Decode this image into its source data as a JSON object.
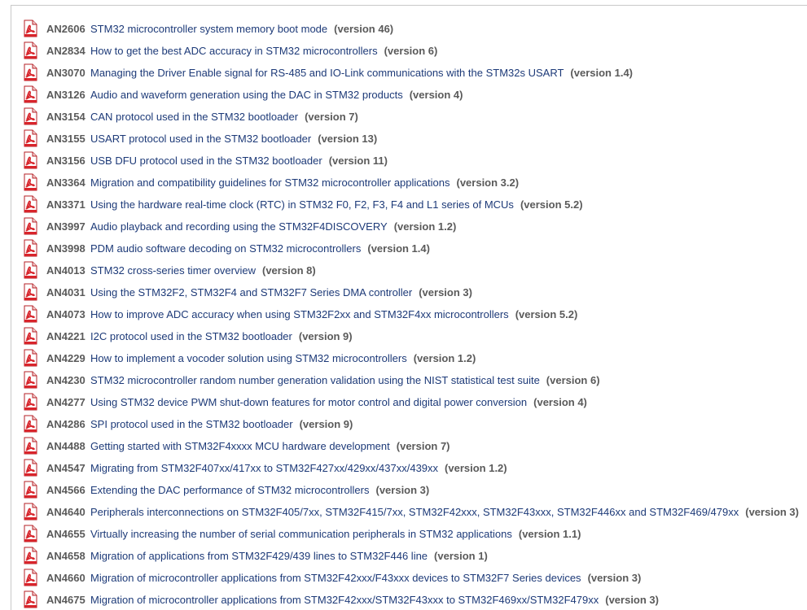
{
  "accent_colors": {
    "link": "#1d3a78",
    "code": "#5a5a5a",
    "pdf_icon": "#d8242b"
  },
  "documents": [
    {
      "code": "AN2606",
      "title": "STM32 microcontroller system memory boot mode",
      "version": "(version 46)",
      "icon": "pdf-icon"
    },
    {
      "code": "AN2834",
      "title": "How to get the best ADC accuracy in STM32 microcontrollers",
      "version": "(version 6)",
      "icon": "pdf-icon"
    },
    {
      "code": "AN3070",
      "title": "Managing the Driver Enable signal for RS-485 and IO-Link communications with the STM32s USART",
      "version": "(version 1.4)",
      "icon": "pdf-icon"
    },
    {
      "code": "AN3126",
      "title": "Audio and waveform generation using the DAC in STM32 products",
      "version": "(version 4)",
      "icon": "pdf-icon"
    },
    {
      "code": "AN3154",
      "title": "CAN protocol used in the STM32 bootloader",
      "version": "(version 7)",
      "icon": "pdf-icon"
    },
    {
      "code": "AN3155",
      "title": "USART protocol used in the STM32 bootloader",
      "version": "(version 13)",
      "icon": "pdf-icon"
    },
    {
      "code": "AN3156",
      "title": "USB DFU protocol used in the STM32 bootloader",
      "version": "(version 11)",
      "icon": "pdf-icon"
    },
    {
      "code": "AN3364",
      "title": "Migration and compatibility guidelines for STM32 microcontroller applications",
      "version": "(version 3.2)",
      "icon": "pdf-icon"
    },
    {
      "code": "AN3371",
      "title": "Using the hardware real-time clock (RTC) in STM32 F0, F2, F3, F4 and L1 series of MCUs",
      "version": "(version 5.2)",
      "icon": "pdf-icon"
    },
    {
      "code": "AN3997",
      "title": "Audio playback and recording using the STM32F4DISCOVERY",
      "version": "(version 1.2)",
      "icon": "pdf-icon"
    },
    {
      "code": "AN3998",
      "title": "PDM audio software decoding on STM32 microcontrollers",
      "version": "(version 1.4)",
      "icon": "pdf-icon"
    },
    {
      "code": "AN4013",
      "title": "STM32 cross-series timer overview",
      "version": "(version 8)",
      "icon": "pdf-icon"
    },
    {
      "code": "AN4031",
      "title": "Using the STM32F2, STM32F4 and STM32F7 Series DMA controller",
      "version": "(version 3)",
      "icon": "pdf-icon"
    },
    {
      "code": "AN4073",
      "title": "How to improve ADC accuracy when using STM32F2xx and STM32F4xx microcontrollers",
      "version": "(version 5.2)",
      "icon": "pdf-icon"
    },
    {
      "code": "AN4221",
      "title": "I2C protocol used in the STM32 bootloader",
      "version": "(version 9)",
      "icon": "pdf-icon"
    },
    {
      "code": "AN4229",
      "title": "How to implement a vocoder solution using STM32 microcontrollers",
      "version": "(version 1.2)",
      "icon": "pdf-icon"
    },
    {
      "code": "AN4230",
      "title": "STM32 microcontroller random number generation validation using the NIST statistical test suite",
      "version": "(version 6)",
      "icon": "pdf-icon"
    },
    {
      "code": "AN4277",
      "title": "Using STM32 device PWM shut-down features for motor control and digital power conversion",
      "version": "(version 4)",
      "icon": "pdf-icon"
    },
    {
      "code": "AN4286",
      "title": "SPI protocol used in the STM32 bootloader",
      "version": "(version 9)",
      "icon": "pdf-icon"
    },
    {
      "code": "AN4488",
      "title": "Getting started with STM32F4xxxx MCU hardware development",
      "version": "(version 7)",
      "icon": "pdf-icon"
    },
    {
      "code": "AN4547",
      "title": "Migrating from STM32F407xx/417xx to STM32F427xx/429xx/437xx/439xx",
      "version": "(version 1.2)",
      "icon": "pdf-icon"
    },
    {
      "code": "AN4566",
      "title": "Extending the DAC performance of STM32 microcontrollers",
      "version": "(version 3)",
      "icon": "pdf-icon"
    },
    {
      "code": "AN4640",
      "title": "Peripherals interconnections on STM32F405/7xx, STM32F415/7xx, STM32F42xxx, STM32F43xxx, STM32F446xx and STM32F469/479xx",
      "version": "(version 3)",
      "icon": "pdf-icon"
    },
    {
      "code": "AN4655",
      "title": "Virtually increasing the number of serial communication peripherals in STM32 applications",
      "version": "(version 1.1)",
      "icon": "pdf-icon"
    },
    {
      "code": "AN4658",
      "title": "Migration of applications from STM32F429/439 lines to STM32F446 line",
      "version": "(version 1)",
      "icon": "pdf-icon"
    },
    {
      "code": "AN4660",
      "title": "Migration of microcontroller applications from STM32F42xxx/F43xxx devices to STM32F7 Series devices",
      "version": "(version 3)",
      "icon": "pdf-icon"
    },
    {
      "code": "AN4675",
      "title": "Migration of microcontroller applications from STM32F42xxx/STM32F43xxx to STM32F469xx/STM32F479xx",
      "version": "(version 3)",
      "icon": "pdf-icon"
    }
  ]
}
